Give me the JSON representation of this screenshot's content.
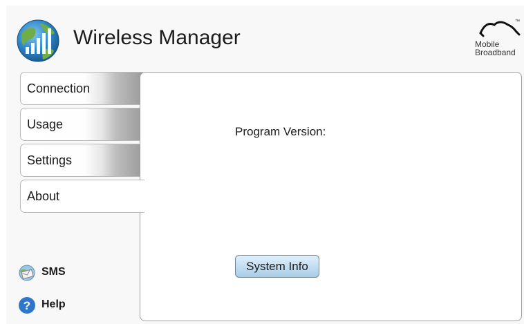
{
  "app": {
    "title": "Wireless Manager",
    "brand_line1": "Mobile",
    "brand_line2": "Broadband",
    "brand_mark": "™"
  },
  "tabs": [
    {
      "label": "Connection",
      "active": false
    },
    {
      "label": "Usage",
      "active": false
    },
    {
      "label": "Settings",
      "active": false
    },
    {
      "label": "About",
      "active": true
    }
  ],
  "about": {
    "version_label": "Program Version:",
    "system_info_button": "System Info"
  },
  "links": {
    "sms_label": "SMS",
    "sms_icon": "envelope-globe-icon",
    "help_label": "Help",
    "help_icon": "question-icon"
  },
  "colors": {
    "help_icon": "#2f77c8",
    "button_top": "#dff0fc",
    "button_bottom": "#a9cde6"
  }
}
